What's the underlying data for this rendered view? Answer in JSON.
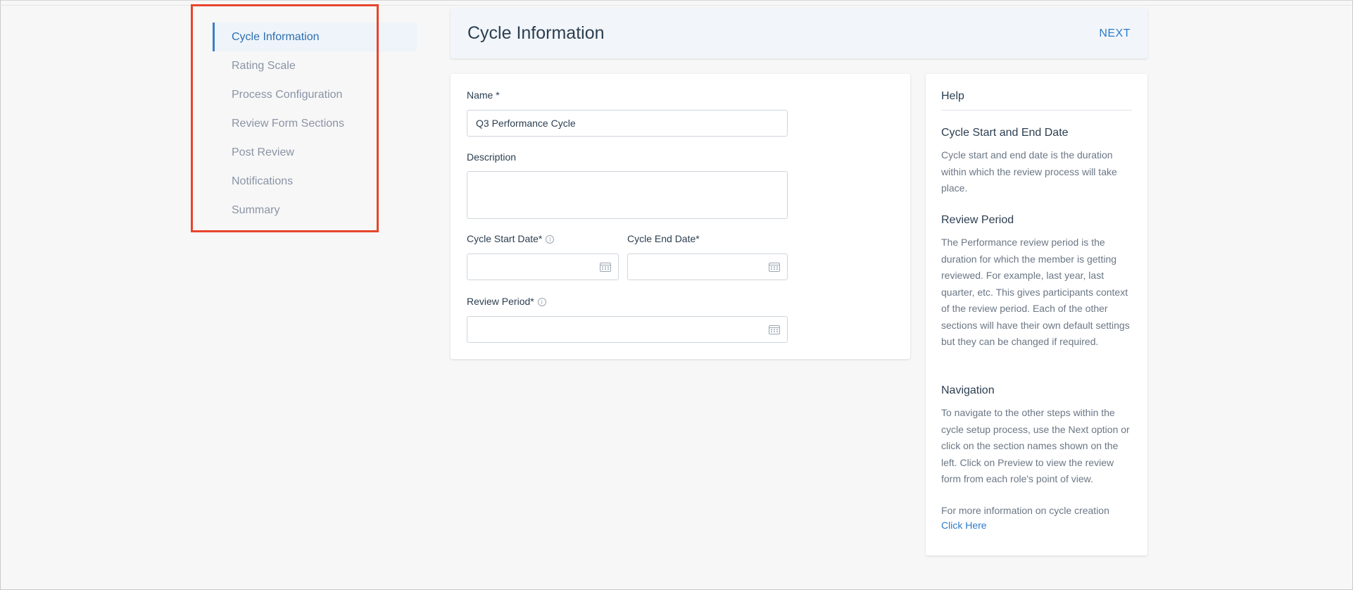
{
  "sidebar": {
    "items": [
      {
        "label": "Cycle Information",
        "active": true
      },
      {
        "label": "Rating Scale"
      },
      {
        "label": "Process Configuration"
      },
      {
        "label": "Review Form Sections"
      },
      {
        "label": "Post Review"
      },
      {
        "label": "Notifications"
      },
      {
        "label": "Summary"
      }
    ]
  },
  "header": {
    "title": "Cycle Information",
    "next_label": "NEXT"
  },
  "form": {
    "name_label": "Name *",
    "name_value": "Q3 Performance Cycle",
    "description_label": "Description",
    "description_value": "",
    "start_date_label": "Cycle Start Date*",
    "start_date_value": "",
    "end_date_label": "Cycle End Date*",
    "end_date_value": "",
    "review_period_label": "Review Period*",
    "review_period_value": "",
    "info_glyph": "i"
  },
  "help": {
    "title": "Help",
    "sections": [
      {
        "heading": "Cycle Start and End Date",
        "text": "Cycle start and end date is the duration within which the review process will take place."
      },
      {
        "heading": "Review Period",
        "text": "The Performance review period is the duration for which the member is getting reviewed. For example, last year, last quarter, etc. This gives participants context of the review period. Each of the other sections will have their own default settings but they can be changed if required."
      },
      {
        "heading": "Navigation",
        "text": "To navigate to the other steps within the cycle setup process, use the Next option or click on the section names shown on the left. Click on Preview to view the review form from each role's point of view."
      }
    ],
    "more_info_text": "For more information on cycle creation",
    "link_label": "Click Here"
  },
  "colors": {
    "accent": "#2f7bc8",
    "highlight": "#e8452c",
    "background": "#f7f7f7"
  }
}
